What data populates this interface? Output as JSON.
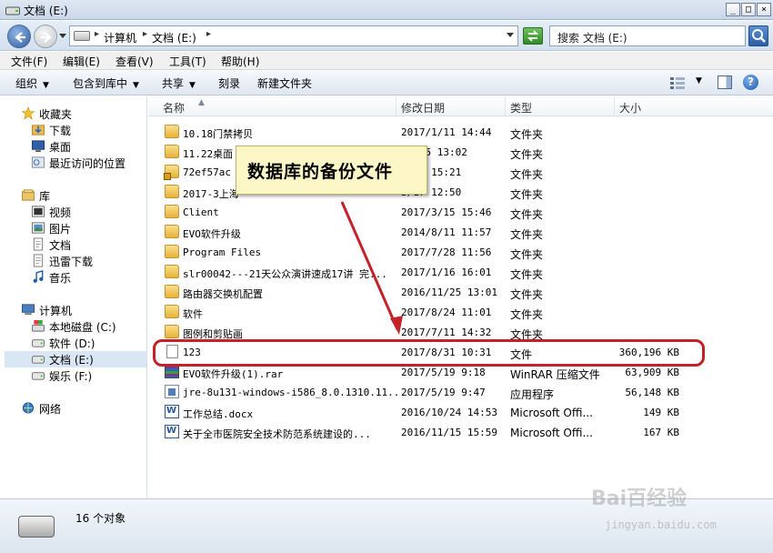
{
  "window": {
    "title": "文档 (E:)",
    "controls": [
      "_",
      "□",
      "×"
    ]
  },
  "address": {
    "crumbs": [
      "计算机",
      "文档 (E:)"
    ],
    "search_placeholder": "搜索 文档 (E:)"
  },
  "menu": [
    "文件(F)",
    "编辑(E)",
    "查看(V)",
    "工具(T)",
    "帮助(H)"
  ],
  "toolbar": [
    "组织",
    "包含到库中",
    "共享",
    "刻录",
    "新建文件夹"
  ],
  "nav": {
    "favorites": {
      "label": "收藏夹",
      "items": [
        "下载",
        "桌面",
        "最近访问的位置"
      ]
    },
    "libraries": {
      "label": "库",
      "items": [
        "视频",
        "图片",
        "文档",
        "迅雷下载",
        "音乐"
      ]
    },
    "computer": {
      "label": "计算机",
      "items": [
        "本地磁盘 (C:)",
        "软件 (D:)",
        "文档 (E:)",
        "娱乐 (F:)"
      ]
    },
    "network": {
      "label": "网络"
    }
  },
  "columns": [
    "名称",
    "修改日期",
    "类型",
    "大小"
  ],
  "files": [
    {
      "name": "10.18门禁拷贝",
      "date": "2017/1/11 14:44",
      "type": "文件夹",
      "size": "",
      "icon": "folder"
    },
    {
      "name": "11.22桌面",
      "date": "11/25 13:02",
      "type": "文件夹",
      "size": "",
      "icon": "folder"
    },
    {
      "name": "72ef57ac",
      "date": "6/28 15:21",
      "type": "文件夹",
      "size": "",
      "icon": "folder-lock"
    },
    {
      "name": "2017-3上海",
      "date": "3/17 12:50",
      "type": "文件夹",
      "size": "",
      "icon": "folder"
    },
    {
      "name": "Client",
      "date": "2017/3/15 15:46",
      "type": "文件夹",
      "size": "",
      "icon": "folder"
    },
    {
      "name": "EVO软件升级",
      "date": "2014/8/11 11:57",
      "type": "文件夹",
      "size": "",
      "icon": "folder"
    },
    {
      "name": "Program Files",
      "date": "2017/7/28 11:56",
      "type": "文件夹",
      "size": "",
      "icon": "folder"
    },
    {
      "name": "slr00042---21天公众演讲速成17讲 完...",
      "date": "2017/1/16 16:01",
      "type": "文件夹",
      "size": "",
      "icon": "folder"
    },
    {
      "name": "路由器交换机配置",
      "date": "2016/11/25 13:01",
      "type": "文件夹",
      "size": "",
      "icon": "folder"
    },
    {
      "name": "软件",
      "date": "2017/8/24 11:01",
      "type": "文件夹",
      "size": "",
      "icon": "folder"
    },
    {
      "name": "图例和剪贴画",
      "date": "2017/7/11 14:32",
      "type": "文件夹",
      "size": "",
      "icon": "folder"
    },
    {
      "name": "123",
      "date": "2017/8/31 10:31",
      "type": "文件",
      "size": "360,196 KB",
      "icon": "file"
    },
    {
      "name": "EVO软件升级(1).rar",
      "date": "2017/5/19 9:18",
      "type": "WinRAR 压缩文件",
      "size": "63,909 KB",
      "icon": "rar"
    },
    {
      "name": "jre-8u131-windows-i586_8.0.1310.11...",
      "date": "2017/5/19 9:47",
      "type": "应用程序",
      "size": "56,148 KB",
      "icon": "exe"
    },
    {
      "name": "工作总结.docx",
      "date": "2016/10/24 14:53",
      "type": "Microsoft Offi...",
      "size": "149 KB",
      "icon": "docx"
    },
    {
      "name": "关于全市医院安全技术防范系统建设的...",
      "date": "2016/11/15 15:59",
      "type": "Microsoft Offi...",
      "size": "167 KB",
      "icon": "docx"
    }
  ],
  "status": {
    "count": "16 个对象"
  },
  "annotation": {
    "callout": "数据库的备份文件",
    "color": "#c42128"
  },
  "watermark": {
    "main": "Bai百经验",
    "url": "jingyan.baidu.com"
  }
}
